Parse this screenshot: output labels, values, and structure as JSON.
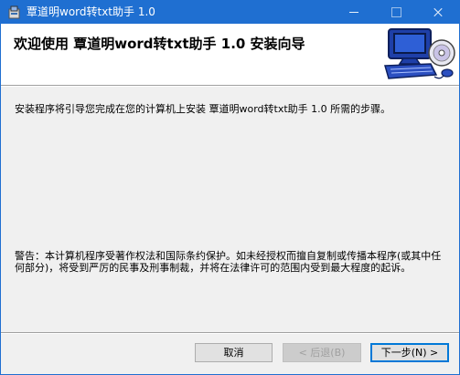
{
  "window": {
    "title": "覃道明word转txt助手 1.0",
    "minimize_label": "",
    "maximize_label": "",
    "close_label": ""
  },
  "header": {
    "heading": "欢迎使用 覃道明word转txt助手 1.0 安装向导"
  },
  "body": {
    "intro": "安装程序将引导您完成在您的计算机上安装 覃道明word转txt助手 1.0 所需的步骤。",
    "warning": "警告：本计算机程序受著作权法和国际条约保护。如未经授权而擅自复制或传播本程序(或其中任何部分)，将受到严厉的民事及刑事制裁，并将在法律许可的范围内受到最大程度的起诉。"
  },
  "buttons": {
    "cancel": "取消",
    "back": "< 后退(B)",
    "next": "下一步(N) >"
  },
  "colors": {
    "titlebar": "#1f6fd1",
    "window_bg": "#f0f0f0",
    "header_bg": "#ffffff",
    "default_button_border": "#0078d7"
  },
  "icons": {
    "app": "installer-box-icon",
    "header_logo": "computer-with-cd-icon"
  }
}
